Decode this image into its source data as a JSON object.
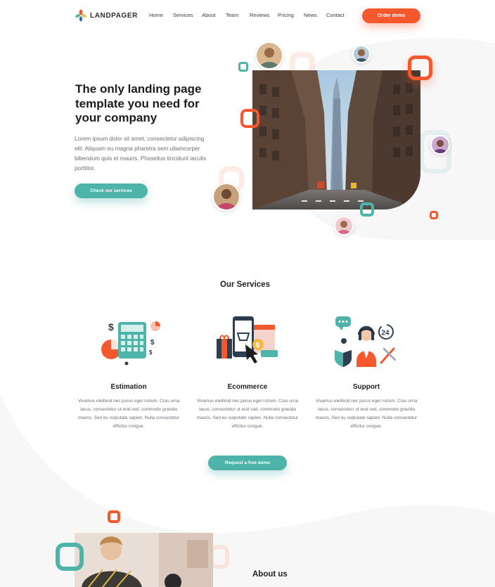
{
  "brand": {
    "name": "LANDPAGER"
  },
  "nav": {
    "items": [
      "Home",
      "Services",
      "About",
      "Team",
      "Reviews",
      "Pricing",
      "News",
      "Contact"
    ],
    "cta": "Order demo"
  },
  "hero": {
    "title": "The only landing page template you need for your company",
    "description": "Lorem ipsum dolor sit amet, consectetur adipiscing elit. Aliquam eu magna pharetra sem ullamcorper bibendum quis et mauris. Phasellus tincidunt iaculis porttitor.",
    "cta": "Check our services"
  },
  "services": {
    "title": "Our Services",
    "items": [
      {
        "name": "Estimation",
        "icon": "calculator-illustration",
        "description": "Vivamus eleifend nec purus eget rutrum. Cras urna lacus, consectetur ut erat sed, commodo gravida mauris. Sed eu vulputate sapien. Nulla consectetur efficitur congue."
      },
      {
        "name": "Ecommerce",
        "icon": "shopping-phone-illustration",
        "description": "Vivamus eleifend nec purus eget rutrum. Cras urna lacus, consectetur ut erat sed, commodo gravida mauris. Sed eu vulputate sapien. Nulla consectetur efficitur congue."
      },
      {
        "name": "Support",
        "icon": "support-agent-illustration",
        "description": "Vivamus eleifend nec purus eget rutrum. Cras urna lacus, consectetur ut erat sed, commodo gravida mauris. Sed eu vulputate sapien. Nulla consectetur efficitur congue."
      }
    ],
    "cta": "Request a free demo",
    "badge_24": "24"
  },
  "about": {
    "title": "About us"
  },
  "colors": {
    "accent": "#f4582c",
    "teal": "#4eb3a9",
    "text": "#1b1b20",
    "muted": "#6c6f77"
  }
}
